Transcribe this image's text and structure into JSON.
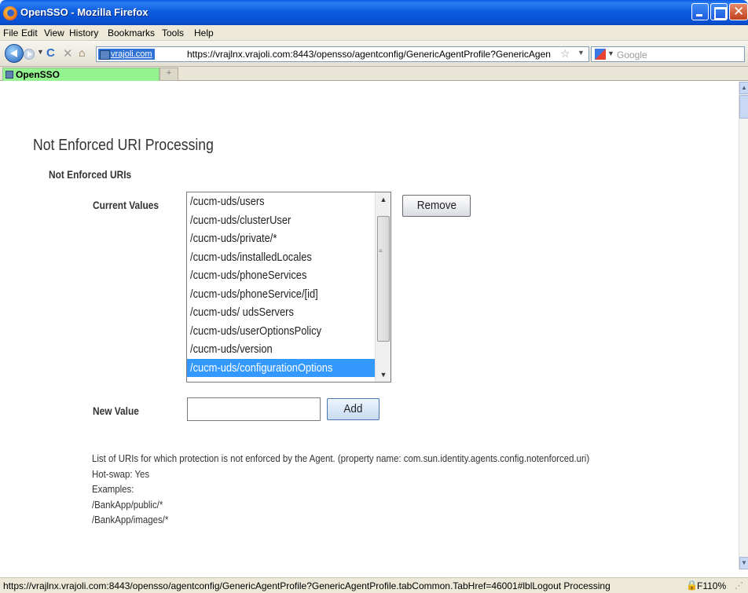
{
  "window": {
    "title": "OpenSSO - Mozilla Firefox"
  },
  "menu": [
    "File",
    "Edit",
    "View",
    "History",
    "Bookmarks",
    "Tools",
    "Help"
  ],
  "nav": {
    "site_identity": "vrajoli.com",
    "url": "https://vrajlnx.vrajoli.com:8443/opensso/agentconfig/GenericAgentProfile?GenericAgen",
    "search_placeholder": "Google"
  },
  "tabs": [
    {
      "label": "OpenSSO"
    }
  ],
  "page": {
    "heading": "Not Enforced URI Processing",
    "section_label": "Not Enforced URIs",
    "current_values_label": "Current Values",
    "current_values": [
      "/cucm-uds/users",
      "/cucm-uds/clusterUser",
      "/cucm-uds/private/*",
      "/cucm-uds/installedLocales",
      "/cucm-uds/phoneServices",
      "/cucm-uds/phoneService/[id]",
      "/cucm-uds/ udsServers",
      "/cucm-uds/userOptionsPolicy",
      "/cucm-uds/version",
      "/cucm-uds/configurationOptions"
    ],
    "selected_value": "/cucm-uds/configurationOptions",
    "remove_label": "Remove",
    "new_value_label": "New Value",
    "new_value": "",
    "add_label": "Add",
    "help_lines": [
      "List of URIs for which protection is not enforced by the Agent. (property name: com.sun.identity.agents.config.notenforced.uri)",
      "Hot-swap: Yes",
      "Examples:",
      "/BankApp/public/*",
      "/BankApp/images/*"
    ]
  },
  "status": {
    "text": "https://vrajlnx.vrajoli.com:8443/opensso/agentconfig/GenericAgentProfile?GenericAgentProfile.tabCommon.TabHref=46001#lblLogout Processing",
    "zoom": "F110%"
  }
}
